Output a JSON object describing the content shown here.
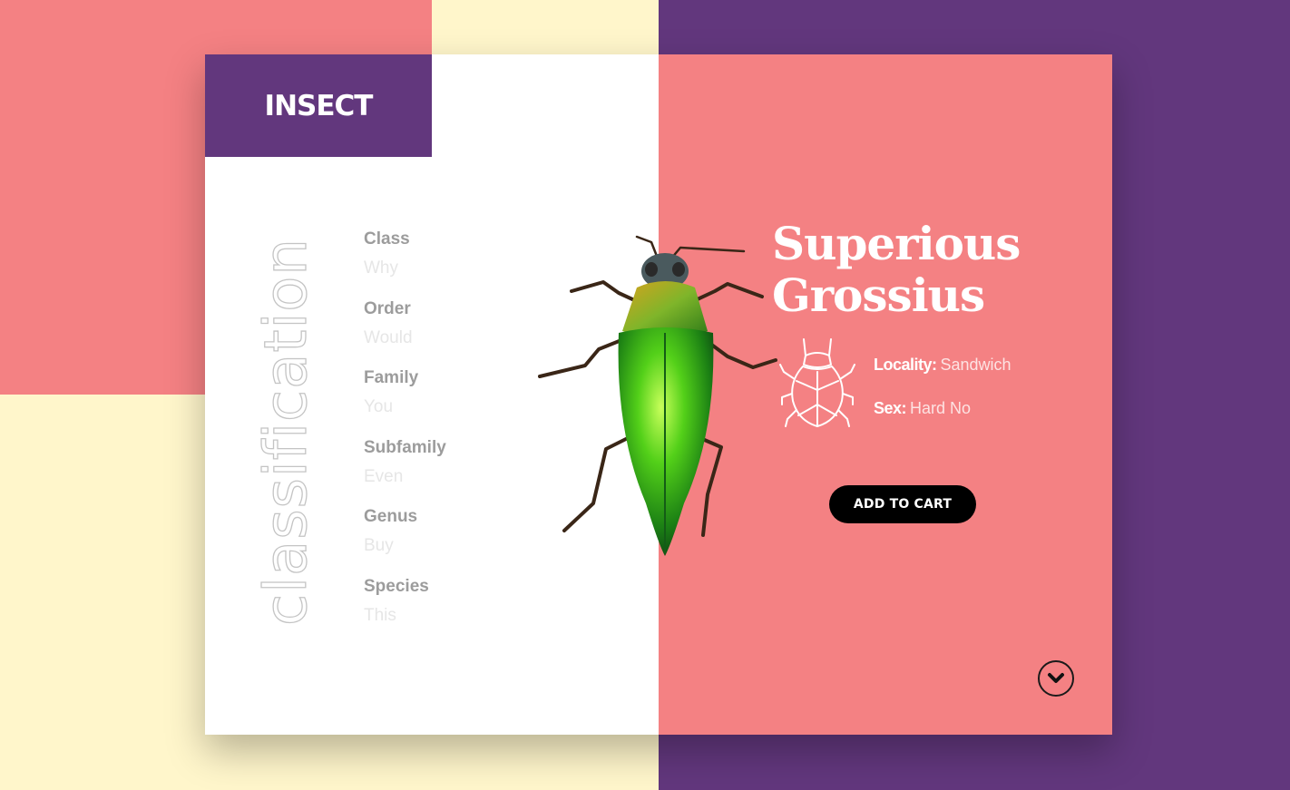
{
  "brand": {
    "label": "INSECT"
  },
  "classification": {
    "heading": "classification",
    "items": [
      {
        "label": "Class",
        "value": "Why"
      },
      {
        "label": "Order",
        "value": "Would"
      },
      {
        "label": "Family",
        "value": "You"
      },
      {
        "label": "Subfamily",
        "value": "Even"
      },
      {
        "label": "Genus",
        "value": "Buy"
      },
      {
        "label": "Species",
        "value": "This"
      }
    ]
  },
  "product": {
    "title_line1": "Superious",
    "title_line2": "Grossius",
    "locality_label": "Locality:",
    "locality_value": "Sandwich",
    "sex_label": "Sex:",
    "sex_value": "Hard No",
    "cart_label": "ADD TO CART"
  },
  "icons": {
    "beetle_outline": "beetle-outline-icon",
    "scroll": "chevron-down-icon"
  },
  "colors": {
    "coral": "#f48183",
    "purple": "#62377d",
    "cream": "#fff6cb",
    "white": "#ffffff",
    "black": "#000000"
  }
}
